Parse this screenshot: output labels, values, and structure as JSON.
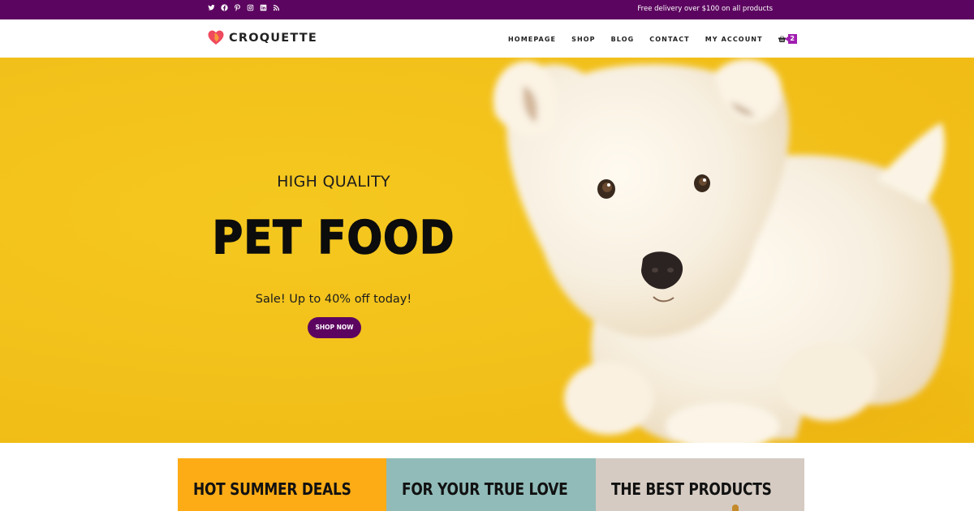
{
  "topbar": {
    "social_icons": [
      "twitter-icon",
      "facebook-icon",
      "pinterest-icon",
      "instagram-icon",
      "linkedin-icon",
      "rss-icon"
    ],
    "delivery_text": "Free delivery over $100 on all products"
  },
  "header": {
    "brand": "CROQUETTE",
    "nav": [
      "HOMEPAGE",
      "SHOP",
      "BLOG",
      "CONTACT",
      "MY ACCOUNT"
    ],
    "cart_count": "2"
  },
  "hero": {
    "eyebrow": "HIGH QUALITY",
    "title": "PET FOOD",
    "subtitle": "Sale! Up to 40% off today!",
    "cta": "SHOP NOW"
  },
  "promos": [
    {
      "label": "HOT SUMMER DEALS",
      "color": "#fdac16"
    },
    {
      "label": "FOR YOUR TRUE LOVE",
      "color": "#90bbb8"
    },
    {
      "label": "THE BEST PRODUCTS",
      "color": "#d5cbc2"
    }
  ],
  "colors": {
    "brand_purple": "#5c0560",
    "hero_yellow": "#f1c11d",
    "badge_magenta": "#a11fb0"
  }
}
